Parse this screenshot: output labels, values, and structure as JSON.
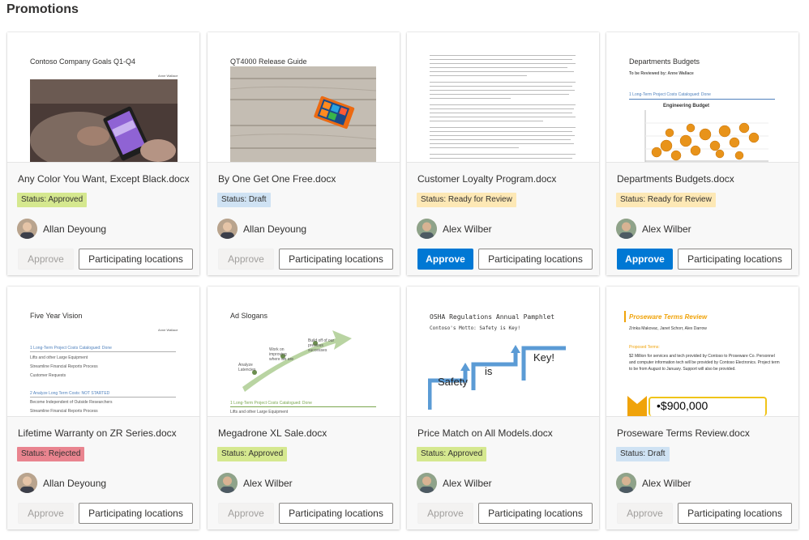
{
  "page": {
    "title": "Promotions"
  },
  "labels": {
    "approve": "Approve",
    "locations": "Participating locations"
  },
  "colors": {
    "approved": "#d5e88f",
    "draft": "#cfe2f3",
    "review": "#fde8b5",
    "rejected": "#e9848f",
    "primary": "#0078d4"
  },
  "cards": [
    {
      "file": "Any Color You Want, Except Black.docx",
      "status": "Status: Approved",
      "status_kind": "approved",
      "person": "Allan Deyoung",
      "approve_enabled": false,
      "preview": {
        "title": "Contoso Company Goals Q1-Q4",
        "author": "Anne Wallace"
      }
    },
    {
      "file": "By One Get One Free.docx",
      "status": "Status: Draft",
      "status_kind": "draft",
      "person": "Allan Deyoung",
      "approve_enabled": false,
      "preview": {
        "title": "QT4000 Release Guide"
      }
    },
    {
      "file": "Customer Loyalty Program.docx",
      "status": "Status: Ready for Review",
      "status_kind": "review",
      "person": "Alex Wilber",
      "approve_enabled": true,
      "preview": {
        "title": ""
      }
    },
    {
      "file": "Departments Budgets.docx",
      "status": "Status: Ready for Review",
      "status_kind": "review",
      "person": "Alex Wilber",
      "approve_enabled": true,
      "preview": {
        "title": "Departments Budgets",
        "subtitle": "To be Reviewed by: Anne Wallace",
        "heading": "1  Long-Term Project Costs Catalogued: Done",
        "chart_title": "Engineering Budget"
      }
    },
    {
      "file": "Lifetime Warranty on ZR Series.docx",
      "status": "Status: Rejected",
      "status_kind": "rejected",
      "person": "Allan Deyoung",
      "approve_enabled": false,
      "preview": {
        "title": "Five Year Vision",
        "author": "Anne Wallace",
        "heading1": "1  Long-Term Project Costs Catalogued: Done",
        "items1": [
          "Lifts and other Large Equipment",
          "Streamline Financial Reports Process",
          "Customer Requests"
        ],
        "heading2": "2  Analyze Long Term Costs: NOT STARTED",
        "items2": [
          "Become Independent of Outside Researchers",
          "Streamline Financial Reports Process"
        ]
      }
    },
    {
      "file": "Megadrone XL Sale.docx",
      "status": "Status: Approved",
      "status_kind": "approved",
      "person": "Alex Wilber",
      "approve_enabled": false,
      "preview": {
        "title": "Ad Slogans",
        "steps": [
          "Analyze Latencies",
          "Work on improving where we are",
          "Build off of our previous successes"
        ],
        "heading": "1  Long-Term Project Costs Catalogued: Done",
        "item": "Lifts and other Large Equipment"
      }
    },
    {
      "file": "Price Match on All Models.docx",
      "status": "Status: Approved",
      "status_kind": "approved",
      "person": "Alex Wilber",
      "approve_enabled": false,
      "preview": {
        "title": "OSHA Regulations Annual Pamphlet",
        "subtitle": "Contoso's Motto: Safety is Key!",
        "words": [
          "Safety",
          "is",
          "Key!"
        ]
      }
    },
    {
      "file": "Proseware Terms Review.docx",
      "status": "Status: Draft",
      "status_kind": "draft",
      "person": "Alex Wilber",
      "approve_enabled": false,
      "preview": {
        "title": "Proseware Terms Review",
        "names": "Zrinka Makovac, Janet Schorr, Alex Darrow",
        "section": "Proposed Terms:",
        "body": "$2 Million for services and tech provided by Contoso to Proseware Co. Personnel and computer information tech will be provided by Contoso Electronics. Project term to be from August to January. Support will also be provided.",
        "amount": "•$900,000"
      }
    }
  ]
}
